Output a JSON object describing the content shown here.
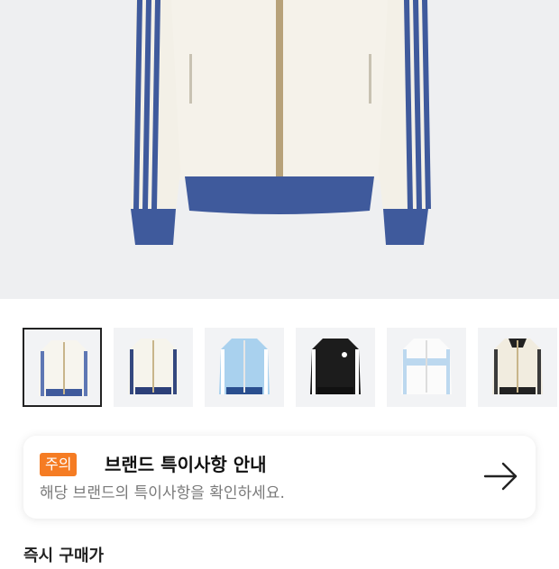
{
  "product": {
    "image_alt": "white track jacket with blue stripes",
    "thumbnails": [
      {
        "name": "cream-blue-jacket",
        "active": true
      },
      {
        "name": "cream-navy-jacket",
        "active": false
      },
      {
        "name": "light-blue-jacket",
        "active": false
      },
      {
        "name": "black-jacket",
        "active": false
      },
      {
        "name": "white-skyblue-jacket",
        "active": false
      },
      {
        "name": "cream-black-jacket",
        "active": false
      }
    ]
  },
  "notice": {
    "badge": "주의",
    "title": "브랜드 특이사항 안내",
    "subtitle": "해당 브랜드의 특이사항을 확인하세요.",
    "icon": "arrow-right-icon",
    "badge_color": "#f57c23"
  },
  "section": {
    "title": "즉시 구매가"
  }
}
